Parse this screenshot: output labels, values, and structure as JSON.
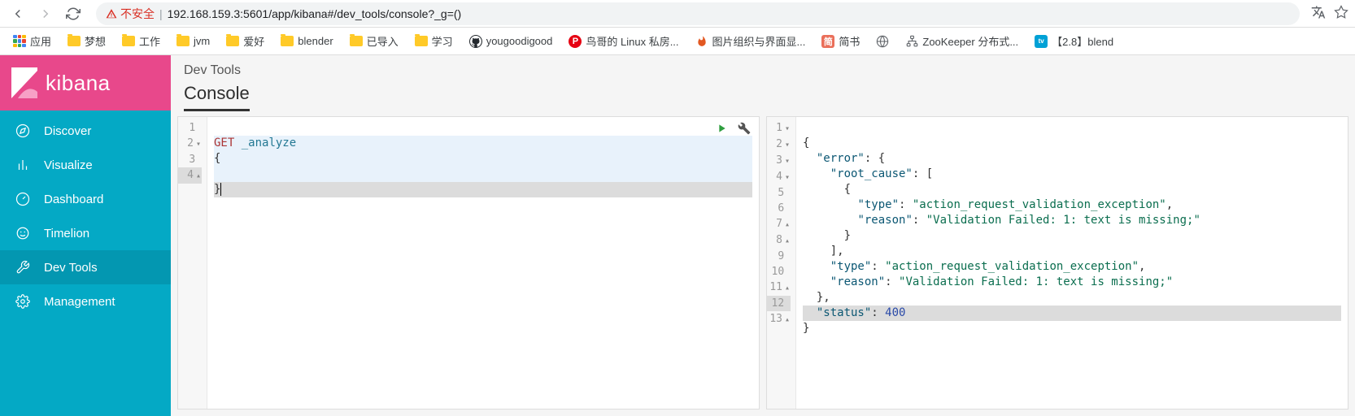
{
  "browser": {
    "insecure_label": "不安全",
    "url": "192.168.159.3:5601/app/kibana#/dev_tools/console?_g=()",
    "apps_label": "应用",
    "bookmarks": [
      {
        "label": "梦想",
        "type": "folder"
      },
      {
        "label": "工作",
        "type": "folder"
      },
      {
        "label": "jvm",
        "type": "folder"
      },
      {
        "label": "爱好",
        "type": "folder"
      },
      {
        "label": "blender",
        "type": "folder"
      },
      {
        "label": "已导入",
        "type": "folder"
      },
      {
        "label": "学习",
        "type": "folder"
      },
      {
        "label": "yougoodigood",
        "type": "github"
      },
      {
        "label": "鸟哥的 Linux 私房...",
        "type": "p"
      },
      {
        "label": "图片组织与界面显...",
        "type": "flame"
      },
      {
        "label": "简书",
        "type": "jian"
      },
      {
        "label": "",
        "type": "globe"
      },
      {
        "label": "ZooKeeper 分布式...",
        "type": "zk"
      },
      {
        "label": "【2.8】blend",
        "type": "bili"
      }
    ]
  },
  "sidebar": {
    "brand": "kibana",
    "items": [
      {
        "label": "Discover"
      },
      {
        "label": "Visualize"
      },
      {
        "label": "Dashboard"
      },
      {
        "label": "Timelion"
      },
      {
        "label": "Dev Tools"
      },
      {
        "label": "Management"
      }
    ]
  },
  "header": {
    "breadcrumb": "Dev Tools",
    "tab": "Console"
  },
  "request": {
    "method": "GET",
    "endpoint": "_analyze",
    "line2": "{",
    "line3": "",
    "line4": "}"
  },
  "response": {
    "l1": "{",
    "l2a": "\"error\"",
    "l2b": ": {",
    "l3a": "\"root_cause\"",
    "l3b": ": [",
    "l4": "{",
    "l5a": "\"type\"",
    "l5b": ": ",
    "l5c": "\"action_request_validation_exception\"",
    "l5d": ",",
    "l6a": "\"reason\"",
    "l6b": ": ",
    "l6c": "\"Validation Failed: 1: text is missing;\"",
    "l7": "}",
    "l8": "],",
    "l9a": "\"type\"",
    "l9b": ": ",
    "l9c": "\"action_request_validation_exception\"",
    "l9d": ",",
    "l10a": "\"reason\"",
    "l10b": ": ",
    "l10c": "\"Validation Failed: 1: text is missing;\"",
    "l11": "},",
    "l12a": "\"status\"",
    "l12b": ": ",
    "l12c": "400",
    "l13": "}"
  }
}
